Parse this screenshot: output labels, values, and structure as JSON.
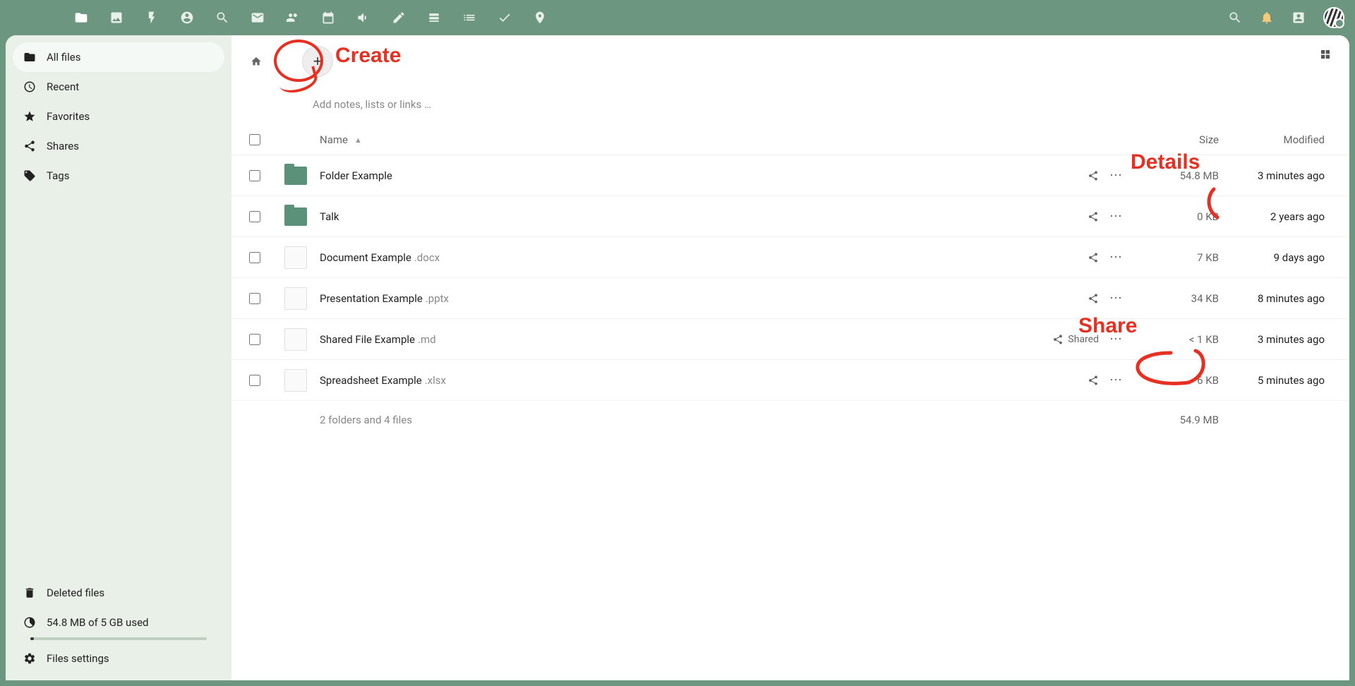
{
  "sidebar": {
    "items": [
      {
        "label": "All files"
      },
      {
        "label": "Recent"
      },
      {
        "label": "Favorites"
      },
      {
        "label": "Shares"
      },
      {
        "label": "Tags"
      }
    ],
    "footer": {
      "deleted": "Deleted files",
      "storage": "54.8 MB of 5 GB used",
      "settings": "Files settings"
    }
  },
  "toolbar": {
    "notes_placeholder": "Add notes, lists or links …"
  },
  "columns": {
    "name": "Name",
    "size": "Size",
    "modified": "Modified"
  },
  "files": [
    {
      "name": "Folder Example",
      "ext": "",
      "type": "folder",
      "size": "54.8 MB",
      "modified": "3 minutes ago",
      "share_label": ""
    },
    {
      "name": "Talk",
      "ext": "",
      "type": "folder",
      "size": "0 KB",
      "modified": "2 years ago",
      "share_label": ""
    },
    {
      "name": "Document Example",
      "ext": ".docx",
      "type": "file",
      "size": "7 KB",
      "modified": "9 days ago",
      "share_label": ""
    },
    {
      "name": "Presentation Example",
      "ext": ".pptx",
      "type": "file",
      "size": "34 KB",
      "modified": "8 minutes ago",
      "share_label": ""
    },
    {
      "name": "Shared File Example",
      "ext": ".md",
      "type": "file",
      "size": "< 1 KB",
      "modified": "3 minutes ago",
      "share_label": "Shared"
    },
    {
      "name": "Spreadsheet Example",
      "ext": ".xlsx",
      "type": "file",
      "size": "6 KB",
      "modified": "5 minutes ago",
      "share_label": ""
    }
  ],
  "summary": {
    "text": "2 folders and 4 files",
    "total_size": "54.9 MB"
  },
  "annotations": {
    "create": "Create",
    "details": "Details",
    "share": "Share"
  }
}
